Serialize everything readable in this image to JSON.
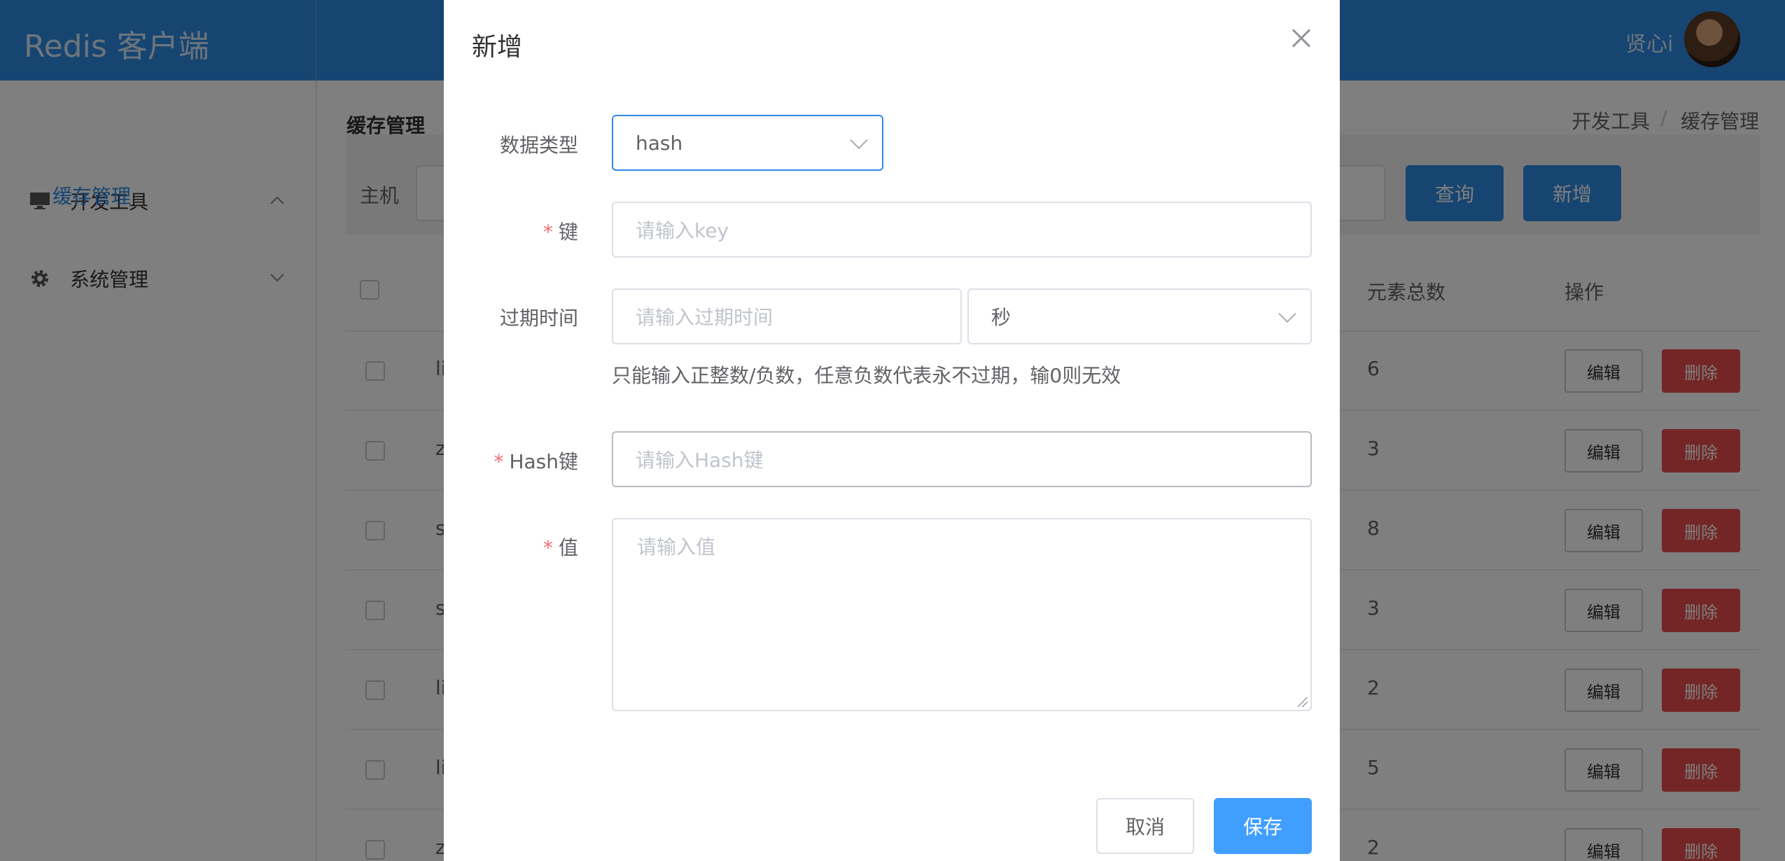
{
  "app": {
    "title": "Redis 客户端",
    "user": "贤心i"
  },
  "sidebar": {
    "items": [
      {
        "label": "开发工具",
        "icon": "monitor-icon",
        "expanded": true,
        "children": [
          {
            "label": "缓存管理",
            "active": true
          }
        ]
      },
      {
        "label": "系统管理",
        "icon": "gear-icon",
        "expanded": false
      }
    ]
  },
  "page": {
    "title": "缓存管理",
    "breadcrumb": [
      "开发工具",
      "/",
      "缓存管理"
    ]
  },
  "search": {
    "host_label": "主机",
    "query_button": "查询",
    "add_button": "新增"
  },
  "table": {
    "headers": {
      "count": "元素总数",
      "actions": "操作"
    },
    "rows": [
      {
        "name": "li",
        "count": "6"
      },
      {
        "name": "z",
        "count": "3"
      },
      {
        "name": "s",
        "count": "8"
      },
      {
        "name": "s",
        "count": "3"
      },
      {
        "name": "li",
        "count": "2"
      },
      {
        "name": "li",
        "count": "5"
      },
      {
        "name": "z",
        "count": "2"
      }
    ],
    "edit_label": "编辑",
    "delete_label": "删除"
  },
  "dialog": {
    "title": "新增",
    "type_label": "数据类型",
    "type_value": "hash",
    "key_label": "键",
    "key_placeholder": "请输入key",
    "expire_label": "过期时间",
    "expire_placeholder": "请输入过期时间",
    "expire_unit": "秒",
    "expire_hint": "只能输入正整数/负数，任意负数代表永不过期，输0则无效",
    "hash_key_label": "Hash键",
    "hash_key_placeholder": "请输入Hash键",
    "value_label": "值",
    "value_placeholder": "请输入值",
    "cancel": "取消",
    "save": "保存"
  },
  "colors": {
    "primary": "#2f8ae3",
    "danger": "#e84d4d",
    "required": "#f56c6c",
    "save": "#409eff"
  }
}
